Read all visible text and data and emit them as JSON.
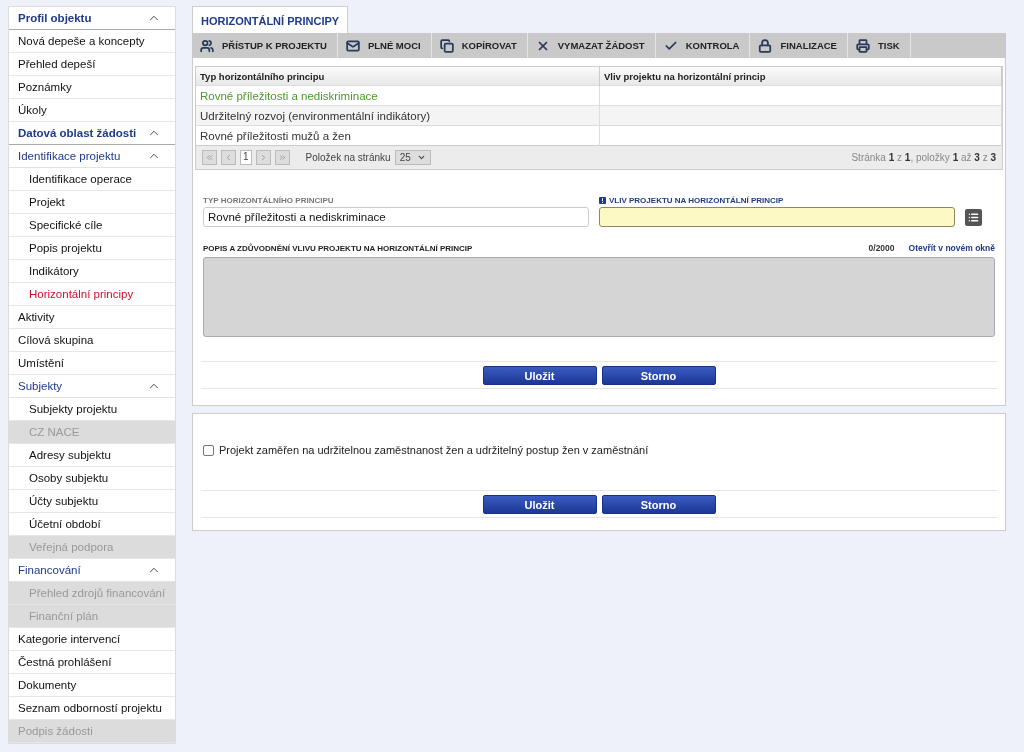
{
  "sidebar": {
    "groups": [
      {
        "label": "Profil objektu",
        "expanded": true,
        "children": [
          {
            "label": "Nová depeše a koncepty",
            "selected": false,
            "disabled": false
          },
          {
            "label": "Přehled depeší",
            "selected": false,
            "disabled": false
          },
          {
            "label": "Poznámky",
            "selected": false,
            "disabled": false
          },
          {
            "label": "Úkoly",
            "selected": false,
            "disabled": false
          }
        ]
      },
      {
        "label": "Datová oblast žádosti",
        "expanded": true,
        "children": [
          {
            "label": "Identifikace projektu",
            "expanded": true,
            "children": [
              {
                "label": "Identifikace operace",
                "selected": false,
                "disabled": false
              },
              {
                "label": "Projekt",
                "selected": false,
                "disabled": false
              },
              {
                "label": "Specifické cíle",
                "selected": false,
                "disabled": false
              },
              {
                "label": "Popis projektu",
                "selected": false,
                "disabled": false
              },
              {
                "label": "Indikátory",
                "selected": false,
                "disabled": false
              },
              {
                "label": "Horizontální principy",
                "selected": true,
                "disabled": false
              }
            ]
          },
          {
            "label": "Aktivity",
            "selected": false,
            "disabled": false
          },
          {
            "label": "Cílová skupina",
            "selected": false,
            "disabled": false
          },
          {
            "label": "Umístění",
            "selected": false,
            "disabled": false
          },
          {
            "label": "Subjekty",
            "expanded": true,
            "children": [
              {
                "label": "Subjekty projektu",
                "selected": false,
                "disabled": false
              },
              {
                "label": "CZ NACE",
                "selected": false,
                "disabled": true
              },
              {
                "label": "Adresy subjektu",
                "selected": false,
                "disabled": false
              },
              {
                "label": "Osoby subjektu",
                "selected": false,
                "disabled": false
              },
              {
                "label": "Účty subjektu",
                "selected": false,
                "disabled": false
              },
              {
                "label": "Účetní období",
                "selected": false,
                "disabled": false
              },
              {
                "label": "Veřejná podpora",
                "selected": false,
                "disabled": true
              }
            ]
          },
          {
            "label": "Financování",
            "expanded": true,
            "children": [
              {
                "label": "Přehled zdrojů financování",
                "selected": false,
                "disabled": true
              },
              {
                "label": "Finanční plán",
                "selected": false,
                "disabled": true
              }
            ]
          },
          {
            "label": "Kategorie intervencí",
            "selected": false,
            "disabled": false
          },
          {
            "label": "Čestná prohlášení",
            "selected": false,
            "disabled": false
          },
          {
            "label": "Dokumenty",
            "selected": false,
            "disabled": false
          },
          {
            "label": "Seznam odborností projektu",
            "selected": false,
            "disabled": false
          },
          {
            "label": "Podpis žádosti",
            "selected": false,
            "disabled": true
          }
        ]
      }
    ]
  },
  "tab": {
    "label": "HORIZONTÁLNÍ PRINCIPY",
    "selected": true
  },
  "toolbar": [
    {
      "kind": "users",
      "label": "PŘÍSTUP K PROJEKTU"
    },
    {
      "kind": "mail",
      "label": "PLNÉ MOCI"
    },
    {
      "kind": "copy",
      "label": "KOPÍROVAT"
    },
    {
      "kind": "delete",
      "label": "VYMAZAT ŽÁDOST"
    },
    {
      "kind": "check",
      "label": "KONTROLA"
    },
    {
      "kind": "lock",
      "label": "FINALIZACE"
    },
    {
      "kind": "print",
      "label": "TISK"
    }
  ],
  "table": {
    "columns": [
      "Typ horizontálního principu",
      "Vliv projektu na horizontální princip"
    ],
    "rows": [
      {
        "cells": [
          "Rovné příležitosti a nediskriminace"
        ],
        "selected": true
      },
      {
        "cells": [
          "Udržitelný rozvoj (environmentální indikátory)"
        ],
        "selected": false
      },
      {
        "cells": [
          "Rovné příležitosti mužů a žen"
        ],
        "selected": false
      }
    ]
  },
  "pager": {
    "page": "1",
    "per_page_label": "Položek na stránku",
    "per_page": "25",
    "summary": "Stránka **1** z **1**, položky **1** až **3** z **3**"
  },
  "form": {
    "type_label": "TYP HORIZONTÁLNÍHO PRINCIPU",
    "type_value": "Rovné příležitosti a nediskriminace",
    "impact_label": "VLIV PROJEKTU NA HORIZONTÁLNÍ PRINCIP",
    "impact_required": true,
    "description_label": "POPIS A ZDŮVODNĚNÍ VLIVU PROJEKTU NA HORIZONTÁLNÍ PRINCIP",
    "counter": "0/2000",
    "open_link": "Otevřít v novém okně",
    "description_disabled": true,
    "buttons": [
      "Uložit",
      "Storno"
    ]
  },
  "focus": {
    "label": "Projekt zaměřen na udržitelnou zaměstnanost žen a udržitelný postup žen v zaměstnání",
    "checked": false,
    "buttons": [
      "Uložit",
      "Storno"
    ]
  }
}
